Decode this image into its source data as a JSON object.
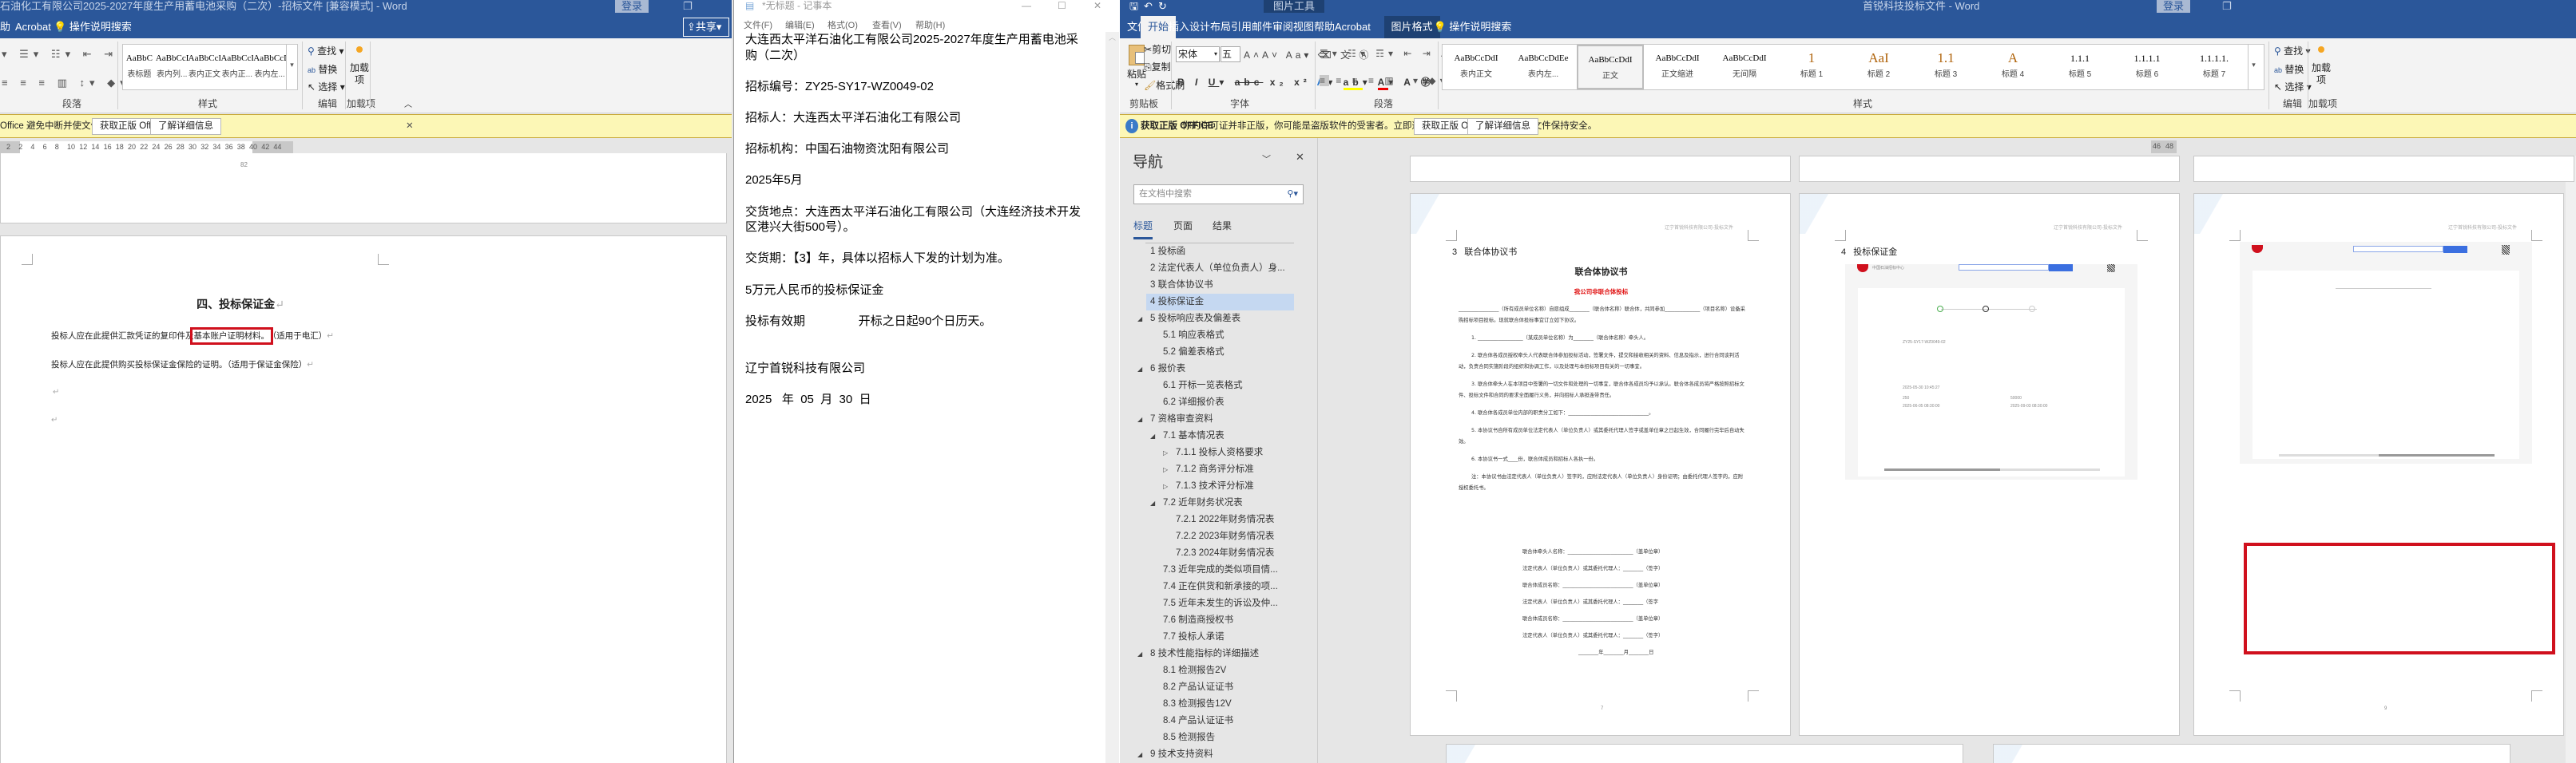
{
  "left_word": {
    "title": "石油化工有限公司2025-2027年度生产用蓄电池采购（二次）-招标文件 [兼容模式]  -  Word",
    "login": "登录",
    "tabs": [
      "助",
      "Acrobat"
    ],
    "tell_me": "操作说明搜索",
    "share": "共享",
    "styles": [
      {
        "sample": "AaBbC",
        "name": "表标题"
      },
      {
        "sample": "AaBbCcD",
        "name": "表内列..."
      },
      {
        "sample": "AaBbCcDdI",
        "name": "表内正文"
      },
      {
        "sample": "AaBbCcDdI",
        "name": "表内正..."
      },
      {
        "sample": "AaBbCcDdEe",
        "name": "表内左..."
      }
    ],
    "groups": {
      "paragraph": "段落",
      "styles": "样式",
      "editing": "编辑",
      "addins": "加载项"
    },
    "editing": {
      "find": "查找",
      "replace": "替换",
      "select": "选择"
    },
    "addins_button": "加载项",
    "notice": "Office 避免中断并使文件保持安全。",
    "notice_btn1": "获取正版 Office",
    "notice_btn2": "了解详细信息",
    "ruler": [
      "2",
      "2",
      "4",
      "6",
      "8",
      "10",
      "12",
      "14",
      "16",
      "18",
      "20",
      "22",
      "24",
      "26",
      "28",
      "30",
      "32",
      "34",
      "36",
      "38",
      "40",
      "42",
      "44"
    ],
    "page_number": "82",
    "doc": {
      "heading": "四、投标保证金",
      "p1_before": "投标人应在此提供汇款凭证的复印件及",
      "p1_highlight": "基本账户证明材料。",
      "p1_after": "（适用于电汇）",
      "p2": "投标人应在此提供购买投标保证金保险的证明。（适用于保证金保险）"
    }
  },
  "notepad": {
    "title": "*无标题 - 记事本",
    "menus": [
      "文件(F)",
      "编辑(E)",
      "格式(O)",
      "查看(V)",
      "帮助(H)"
    ],
    "lines": [
      "大连西太平洋石油化工有限公司2025-2027年度生产用蓄电池采",
      "购（二次）",
      "",
      "招标编号：ZY25-SY17-WZ0049-02",
      "",
      "招标人：大连西太平洋石油化工有限公司",
      "",
      "招标机构：中国石油物资沈阳有限公司",
      "",
      "2025年5月",
      "",
      "交货地点：大连西太平洋石油化工有限公司（大连经济技术开发",
      "区港兴大街500号）。",
      "",
      "交货期：【3】年，具体以招标人下发的计划为准。",
      "",
      "5万元人民币的投标保证金",
      "",
      "投标有效期                开标之日起90个日历天。",
      "",
      "",
      "辽宁首锐科技有限公司",
      "",
      "2025   年  05  月  30  日"
    ]
  },
  "right_word": {
    "title": "首锐科技投标文件  -  Word",
    "context_tab_group": "图片工具",
    "login": "登录",
    "tabs": [
      "文件",
      "开始",
      "插入",
      "设计",
      "布局",
      "引用",
      "邮件",
      "审阅",
      "视图",
      "帮助",
      "Acrobat",
      "图片格式"
    ],
    "active_tab": "开始",
    "tell_me": "操作说明搜索",
    "clipboard": {
      "paste": "粘贴",
      "cut": "剪切",
      "copy": "复制",
      "format_painter": "格式刷",
      "label": "剪贴板"
    },
    "font": {
      "name": "宋体",
      "size": "五号",
      "label": "字体"
    },
    "paragraph_label": "段落",
    "styles": [
      {
        "sample": "AaBbCcDdI",
        "name": "表内正文"
      },
      {
        "sample": "AaBbCcDdEe",
        "name": "表内左..."
      },
      {
        "sample": "AaBbCcDdI",
        "name": "正文",
        "selected": true
      },
      {
        "sample": "AaBbCcDdI",
        "name": "正文缩进"
      },
      {
        "sample": "AaBbCcDdI",
        "name": "无间隔"
      },
      {
        "sample": "1",
        "name": "标题 1"
      },
      {
        "sample": "AaI",
        "name": "标题 2"
      },
      {
        "sample": "1.1",
        "name": "标题 3"
      },
      {
        "sample": "A",
        "name": "标题 4"
      },
      {
        "sample": "1.1.1",
        "name": "标题 5"
      },
      {
        "sample": "1.1.1.1",
        "name": "标题 6"
      },
      {
        "sample": "1.1.1.1.",
        "name": "标题 7"
      }
    ],
    "styles_label": "样式",
    "editing": {
      "find": "查找",
      "replace": "替换",
      "select": "选择",
      "label": "编辑"
    },
    "addins": {
      "button": "加载项",
      "label": "加载项"
    },
    "notice": {
      "title": "获取正版 OFFICE",
      "text": "你的许可证并非正版，你可能是盗版软件的受害者。立即通过正版 Office 避免中断并使文件保持安全。",
      "btn1": "获取正版 Office",
      "btn2": "了解详细信息"
    },
    "ruler_end": [
      "46",
      "48"
    ],
    "nav": {
      "title": "导航",
      "search_placeholder": "在文档中搜索",
      "tabs": [
        "标题",
        "页面",
        "结果"
      ],
      "items": [
        {
          "text": "1 投标函",
          "level": 1,
          "arrow": ""
        },
        {
          "text": "2 法定代表人（单位负责人）身...",
          "level": 1,
          "arrow": ""
        },
        {
          "text": "3 联合体协议书",
          "level": 1,
          "arrow": ""
        },
        {
          "text": "4 投标保证金",
          "level": 1,
          "arrow": "",
          "selected": true
        },
        {
          "text": "5 投标响应表及偏差表",
          "level": 1,
          "arrow": "◢"
        },
        {
          "text": "5.1 响应表格式",
          "level": 2,
          "arrow": ""
        },
        {
          "text": "5.2 偏差表格式",
          "level": 2,
          "arrow": ""
        },
        {
          "text": "6 报价表",
          "level": 1,
          "arrow": "◢"
        },
        {
          "text": "6.1 开标一览表格式",
          "level": 2,
          "arrow": ""
        },
        {
          "text": "6.2 详细报价表",
          "level": 2,
          "arrow": ""
        },
        {
          "text": "7 资格审查资料",
          "level": 1,
          "arrow": "◢"
        },
        {
          "text": "7.1 基本情况表",
          "level": 2,
          "arrow": "◢"
        },
        {
          "text": "7.1.1 投标人资格要求",
          "level": 3,
          "arrow": "▷"
        },
        {
          "text": "7.1.2 商务评分标准",
          "level": 3,
          "arrow": "▷"
        },
        {
          "text": "7.1.3 技术评分标准",
          "level": 3,
          "arrow": "▷"
        },
        {
          "text": "7.2 近年财务状况表",
          "level": 2,
          "arrow": "◢"
        },
        {
          "text": "7.2.1 2022年财务情况表",
          "level": 3,
          "arrow": ""
        },
        {
          "text": "7.2.2 2023年财务情况表",
          "level": 3,
          "arrow": ""
        },
        {
          "text": "7.2.3 2024年财务情况表",
          "level": 3,
          "arrow": ""
        },
        {
          "text": "7.3 近年完成的类似项目情...",
          "level": 2,
          "arrow": ""
        },
        {
          "text": "7.4 正在供货和新承接的项...",
          "level": 2,
          "arrow": ""
        },
        {
          "text": "7.5 近年未发生的诉讼及仲...",
          "level": 2,
          "arrow": ""
        },
        {
          "text": "7.6 制造商授权书",
          "level": 2,
          "arrow": ""
        },
        {
          "text": "7.7 投标人承诺",
          "level": 2,
          "arrow": ""
        },
        {
          "text": "8 技术性能指标的详细描述",
          "level": 1,
          "arrow": "◢"
        },
        {
          "text": "8.1 检测报告2V",
          "level": 2,
          "arrow": ""
        },
        {
          "text": "8.2 产品认证证书",
          "level": 2,
          "arrow": ""
        },
        {
          "text": "8.3 检测报告12V",
          "level": 2,
          "arrow": ""
        },
        {
          "text": "8.4 产品认证证书",
          "level": 2,
          "arrow": ""
        },
        {
          "text": "8.5 检测报告",
          "level": 2,
          "arrow": ""
        },
        {
          "text": "9 技术支持资料",
          "level": 1,
          "arrow": "◢"
        }
      ]
    },
    "header_text": "辽宁首锐科技有限公司-投标文件",
    "page1": {
      "section": "3   联合体协议书",
      "title": "联合体协议书",
      "red_note": "我公司非联合体投标",
      "paragraphs": [
        "________________（所有成员单位名称）自愿组成________（联合体名称）联合体，共同参加______________（项目名称）设备采购招标项目投标。现就联合体投标事宜订立如下协议。",
        "1.  __________________（某成员单位名称）为________（联合体名称）牵头人。",
        "2.  联合体各成员授权牵头人代表联合体参加投标活动，签署文件，提交和接收相关的资料、信息及指示，进行合同谈判活动，负责合同实施阶段的组织和协调工作，以及处理与本招标项目有关的一切事宜。",
        "3.  联合体牵头人在本项目中签署的一切文件和处理的一切事宜，联合体各成员均予以承认。联合体各成员将严格按照招标文件、投标文件和合同的要求全面履行义务，并向招标人承担连带责任。",
        "4.  联合体各成员单位内部的职责分工如下：________________________________。",
        "5.  本协议书自所有成员单位法定代表人（单位负责人）或其委托代理人签字或盖单位章之日起生效，合同履行完毕后自动失效。",
        "6.  本协议书一式____份，联合体成员和招标人各执一份。",
        "注：本协议书由法定代表人（单位负责人）签字的，应附法定代表人（单位负责人）身份证明；由委托代理人签字的，应附授权委托书。"
      ],
      "signatures": [
        "联合体牵头人名称：__________________________（盖单位章）",
        "法定代表人（单位负责人）或其委托代理人：________（签字）",
        "联合体成员名称：____________________________（盖单位章）",
        "法定代表人（单位负责人）或其委托代理人：________（签字",
        "联合体成员名称：____________________________（盖单位章）",
        "法定代表人（单位负责人）或其委托代理人：________（签字）",
        "________年________月________日"
      ],
      "page_number": "7"
    },
    "page2": {
      "section": "4   投标保证金",
      "shot": {
        "org": "中国石油招标中心",
        "project_no": "ZY25-SY17-WZ0049-02",
        "time": "2025-05-30 10:45:27",
        "amount": "250",
        "insured": "50000",
        "start": "2025-06-05 08:30:00",
        "end": "2025-09-03 08:30:00"
      }
    },
    "page3": {
      "page_number": "9"
    },
    "accent": "#2b579a",
    "highlight_box_color": "#d0101d"
  }
}
